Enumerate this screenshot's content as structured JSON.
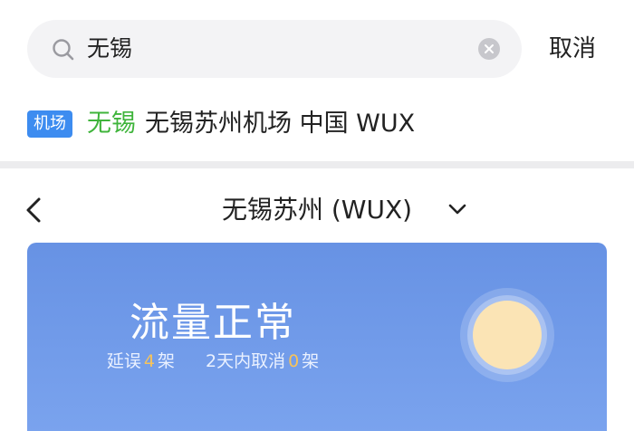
{
  "search": {
    "value": "无锡",
    "icon": "search-icon",
    "clear_icon": "clear-icon",
    "cancel_label": "取消"
  },
  "result": {
    "tag": "机场",
    "highlight": "无锡",
    "text": "无锡苏州机场 中国 WUX"
  },
  "airport_header": {
    "title": "无锡苏州 (WUX)",
    "back_icon": "back-chevron-icon",
    "dropdown_icon": "chevron-down-icon"
  },
  "status": {
    "title": "流量正常",
    "delayed_label": "延误",
    "delayed_count": "4",
    "delayed_unit": "架",
    "cancelled_label": "2天内取消",
    "cancelled_count": "0",
    "cancelled_unit": "架",
    "weather_icon": "sun-icon"
  },
  "colors": {
    "highlight_green": "#3fb43b",
    "tag_blue": "#3d8cf0",
    "card_blue": "#6792e4",
    "count_orange": "#f7c35a",
    "sun_yellow": "#fbe4b5"
  }
}
